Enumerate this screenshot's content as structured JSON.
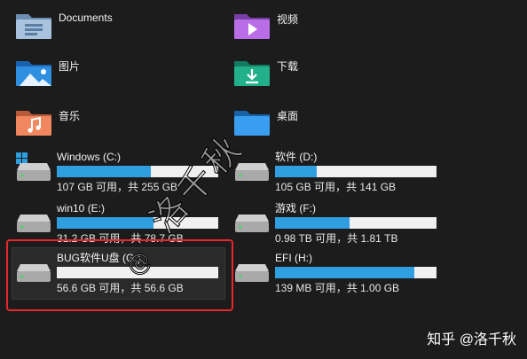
{
  "folders": [
    {
      "name": "Documents",
      "icon": "documents-folder-icon"
    },
    {
      "name": "视频",
      "icon": "videos-folder-icon"
    },
    {
      "name": "图片",
      "icon": "pictures-folder-icon"
    },
    {
      "name": "下载",
      "icon": "downloads-folder-icon"
    },
    {
      "name": "音乐",
      "icon": "music-folder-icon"
    },
    {
      "name": "桌面",
      "icon": "desktop-folder-icon"
    }
  ],
  "drives": [
    {
      "name": "Windows (C:)",
      "stat": "107 GB 可用，共 255 GB",
      "used_fraction": 0.58,
      "icon": "windows-drive-icon"
    },
    {
      "name": "软件 (D:)",
      "stat": "105 GB 可用，共 141 GB",
      "used_fraction": 0.26,
      "icon": "hard-drive-icon"
    },
    {
      "name": "win10 (E:)",
      "stat": "31.2 GB 可用，共 78.7 GB",
      "used_fraction": 0.6,
      "icon": "hard-drive-icon"
    },
    {
      "name": "游戏 (F:)",
      "stat": "0.98 TB 可用，共 1.81 TB",
      "used_fraction": 0.46,
      "icon": "hard-drive-icon"
    },
    {
      "name": "BUG软件U盘 (G:)",
      "stat": "56.6 GB 可用，共 56.6 GB",
      "used_fraction": 0.0,
      "icon": "usb-drive-icon"
    },
    {
      "name": "EFI (H:)",
      "stat": "139 MB 可用，共 1.00 GB",
      "used_fraction": 0.86,
      "icon": "hard-drive-icon"
    }
  ],
  "watermark": {
    "text": "洛千秋",
    "handle": "@"
  },
  "footer": {
    "credit": "知乎 @洛千秋"
  },
  "colors": {
    "background": "#1c1c1c",
    "bar_fill": "#2f9fe0",
    "bar_track": "#f0f0f0",
    "highlight": "#e8262d"
  }
}
